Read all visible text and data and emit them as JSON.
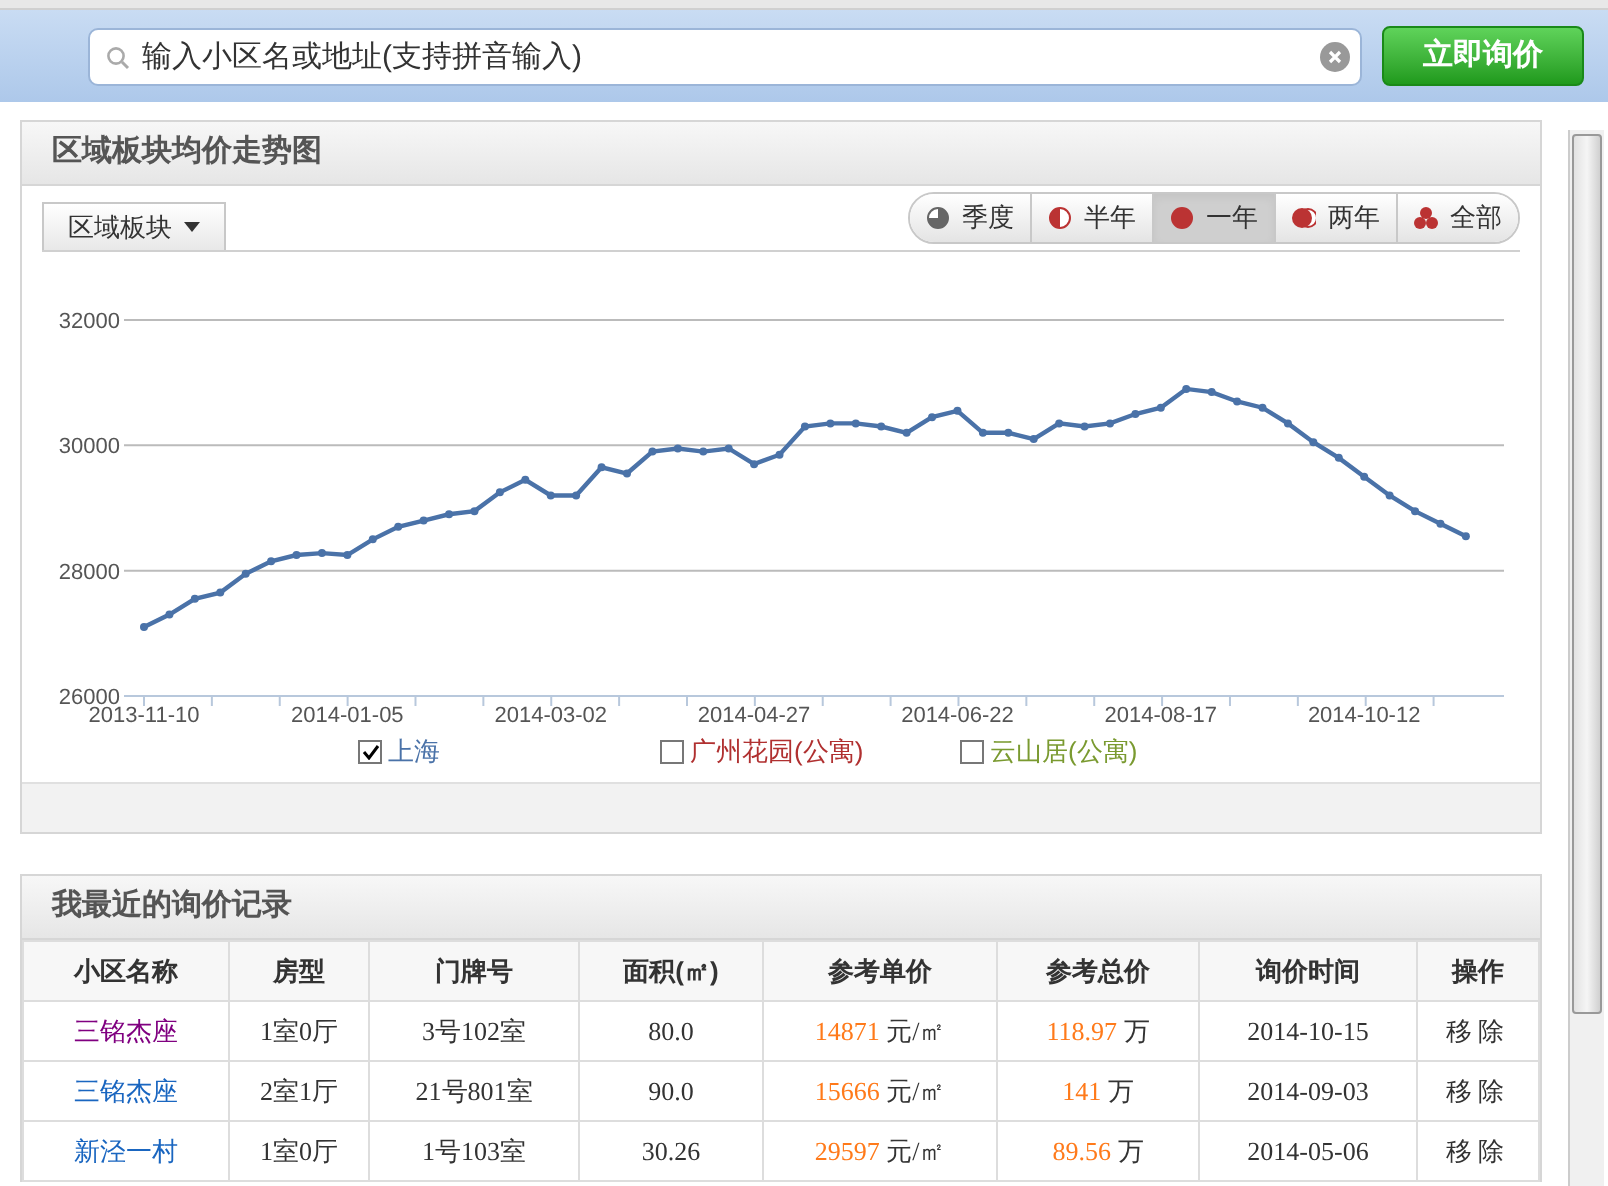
{
  "search": {
    "placeholder": "输入小区名或地址(支持拼音输入)"
  },
  "query_button": "立即询价",
  "trend_panel": {
    "title": "区域板块均价走势图",
    "dropdown": "区域板块",
    "periods": [
      {
        "label": "季度",
        "selected": false
      },
      {
        "label": "半年",
        "selected": false
      },
      {
        "label": "一年",
        "selected": true
      },
      {
        "label": "两年",
        "selected": false
      },
      {
        "label": "全部",
        "selected": false
      }
    ],
    "chart_data": {
      "type": "line",
      "categories": [
        "2013-11-10",
        null,
        null,
        null,
        null,
        null,
        null,
        null,
        "2014-01-05",
        null,
        null,
        null,
        null,
        null,
        null,
        null,
        "2014-03-02",
        null,
        null,
        null,
        null,
        null,
        null,
        null,
        "2014-04-27",
        null,
        null,
        null,
        null,
        null,
        null,
        null,
        "2014-06-22",
        null,
        null,
        null,
        null,
        null,
        null,
        null,
        "2014-08-17",
        null,
        null,
        null,
        null,
        null,
        null,
        null,
        "2014-10-12",
        null,
        null,
        null,
        null
      ],
      "series": [
        {
          "name": "上海",
          "color": "#4a72a8",
          "marker": "circle",
          "values": [
            27100,
            27300,
            27550,
            27650,
            27950,
            28150,
            28250,
            28280,
            28250,
            28500,
            28700,
            28800,
            28900,
            28950,
            29250,
            29450,
            29200,
            29200,
            29650,
            29550,
            29900,
            29950,
            29900,
            29950,
            29700,
            29850,
            30300,
            30350,
            30350,
            30300,
            30200,
            30450,
            30550,
            30200,
            30200,
            30100,
            30350,
            30300,
            30350,
            30500,
            30600,
            30900,
            30850,
            30700,
            30600,
            30350,
            30050,
            29800,
            29500,
            29200,
            28950,
            28750,
            28550
          ]
        }
      ],
      "ylim": [
        26000,
        32000
      ],
      "yticks": [
        26000,
        28000,
        30000,
        32000
      ]
    },
    "legend": [
      {
        "checked": true
      },
      {
        "label": "广州花园(公寓)",
        "checked": false,
        "color": "#b03030"
      },
      {
        "label": "云山居(公寓)",
        "checked": false,
        "color": "#7a9a30"
      }
    ]
  },
  "history_panel": {
    "title": "我最近的询价记录",
    "columns": [
      "小区名称",
      "房型",
      "门牌号",
      "面积(㎡)",
      "参考单价",
      "参考总价",
      "询价时间",
      "操作"
    ],
    "rows": [
      {
        "community": "三铭杰座",
        "visited": true,
        "layout": "1室0厅",
        "unit": "3号102室",
        "area": "80.0",
        "unit_price": "14871",
        "unit_price_unit": "元/㎡",
        "total_price": "118.97",
        "total_price_unit": "万",
        "time": "2014-10-15",
        "action": "移除"
      },
      {
        "community": "三铭杰座",
        "visited": false,
        "layout": "2室1厅",
        "unit": "21号801室",
        "area": "90.0",
        "unit_price": "15666",
        "unit_price_unit": "元/㎡",
        "total_price": "141",
        "total_price_unit": "万",
        "time": "2014-09-03",
        "action": "移除"
      },
      {
        "community": "新泾一村",
        "visited": false,
        "layout": "1室0厅",
        "unit": "1号103室",
        "area": "30.26",
        "unit_price": "29597",
        "unit_price_unit": "元/㎡",
        "total_price": "89.56",
        "total_price_unit": "万",
        "time": "2014-05-06",
        "action": "移除"
      }
    ]
  }
}
